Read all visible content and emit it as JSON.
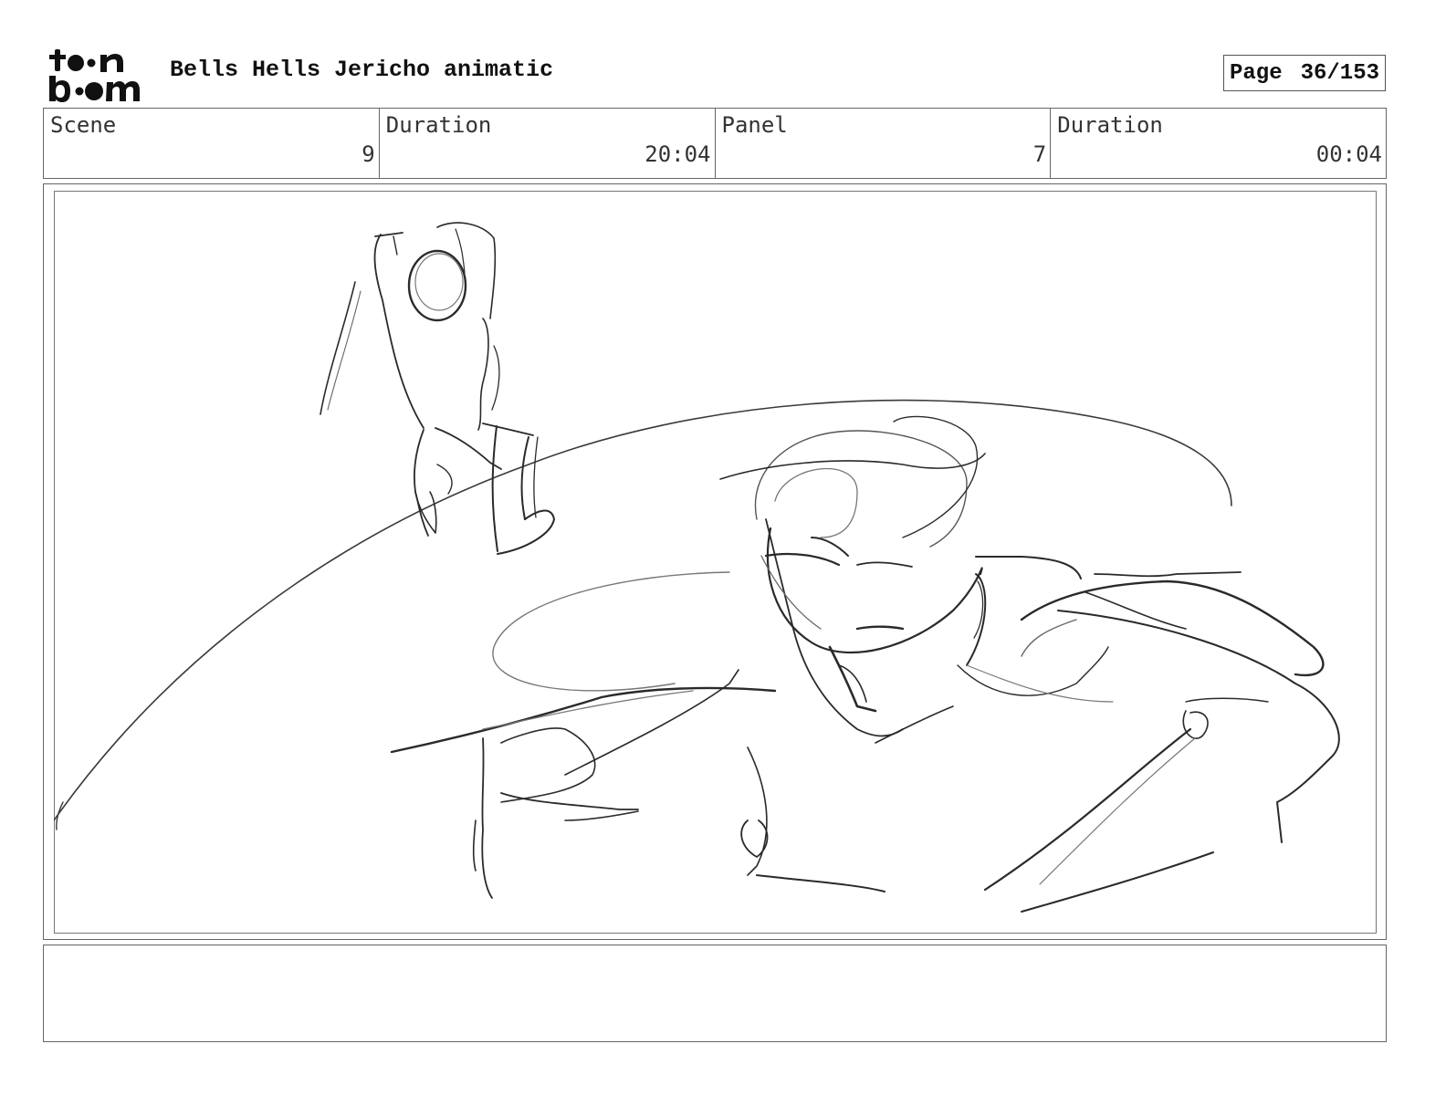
{
  "header": {
    "logo_top": "t●●n",
    "logo_bottom": "b●●m",
    "title": "Bells Hells Jericho animatic",
    "page_label": "Page",
    "page_value": "36/153"
  },
  "info": {
    "scene_label": "Scene",
    "scene_value": "9",
    "scene_duration_label": "Duration",
    "scene_duration_value": "20:04",
    "panel_label": "Panel",
    "panel_value": "7",
    "panel_duration_label": "Duration",
    "panel_duration_value": "00:04"
  },
  "panel": {
    "image": "pencil-sketch-two-figures",
    "notes": ""
  },
  "colors": {
    "border": "#666666",
    "sketch_line": "#2a2a2a",
    "sketch_light": "#8a8a8a"
  }
}
